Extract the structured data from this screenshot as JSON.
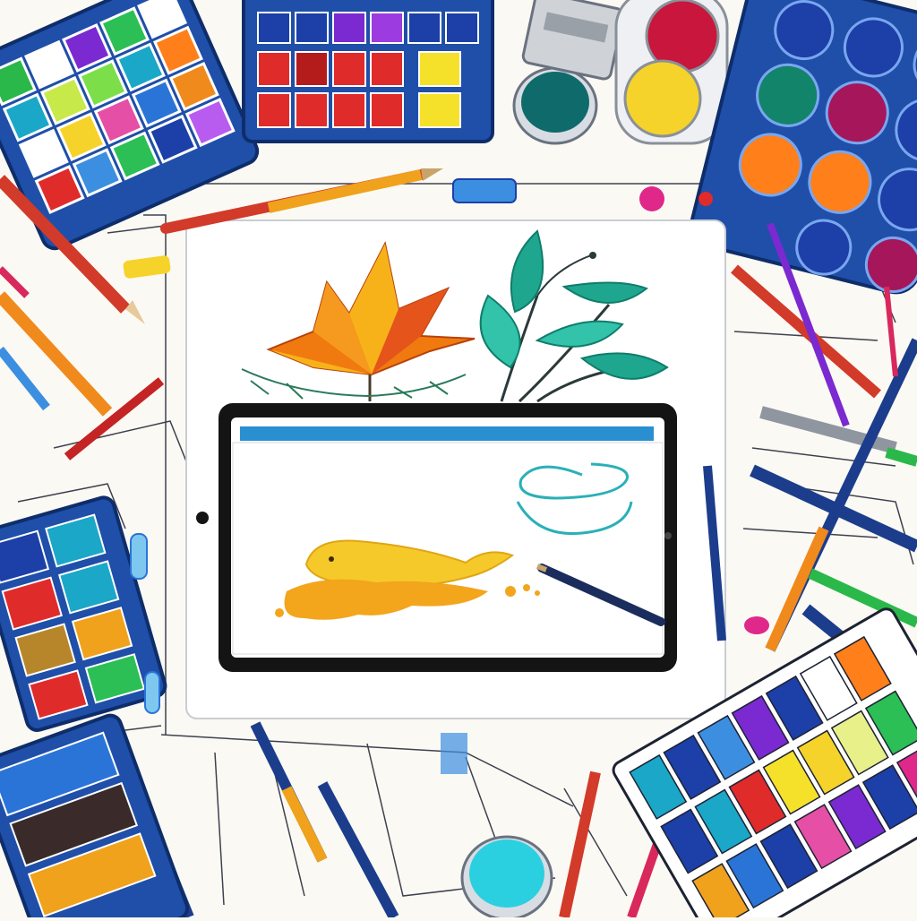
{
  "scene": {
    "background_color": "#fbf9f3",
    "line_color": "#1d2233",
    "palette_frame_color": "#1f4fa8",
    "description_title": ""
  },
  "tablet": {
    "frame_color": "#ffffff",
    "screen_bezel_color": "#141414",
    "toolbar_color": "#2a8fd0",
    "canvas_color": "#ffffff",
    "screen_caption": ""
  },
  "artwork": {
    "leaf_colors": [
      "#f07a10",
      "#f7b21a",
      "#e5541b"
    ],
    "plant_colors": [
      "#1fa68f",
      "#33c2aa",
      "#0f7d6b"
    ],
    "fish_color": "#f6c92a",
    "splash_color": "#f3a51c",
    "scribble_color": "#2ab0b8"
  },
  "supplies": {
    "pencil_colors": [
      "#d23a2a",
      "#f08a1c",
      "#1b3d8c",
      "#2bb84a",
      "#6a4bd8",
      "#d8285c",
      "#3c8fe0",
      "#ffffff"
    ],
    "paint_colors": [
      "#e02b2b",
      "#f6d32a",
      "#1aa7c8",
      "#ff7f1a",
      "#7a2ad0",
      "#2bbf55",
      "#e64fa6",
      "#1c3fa8",
      "#ffffff",
      "#b41c1c"
    ],
    "icons": [
      "watercolor-palette-icon",
      "paint-pot-icon",
      "colored-pencil-icon",
      "drawing-tablet-icon",
      "stylus-icon"
    ]
  }
}
